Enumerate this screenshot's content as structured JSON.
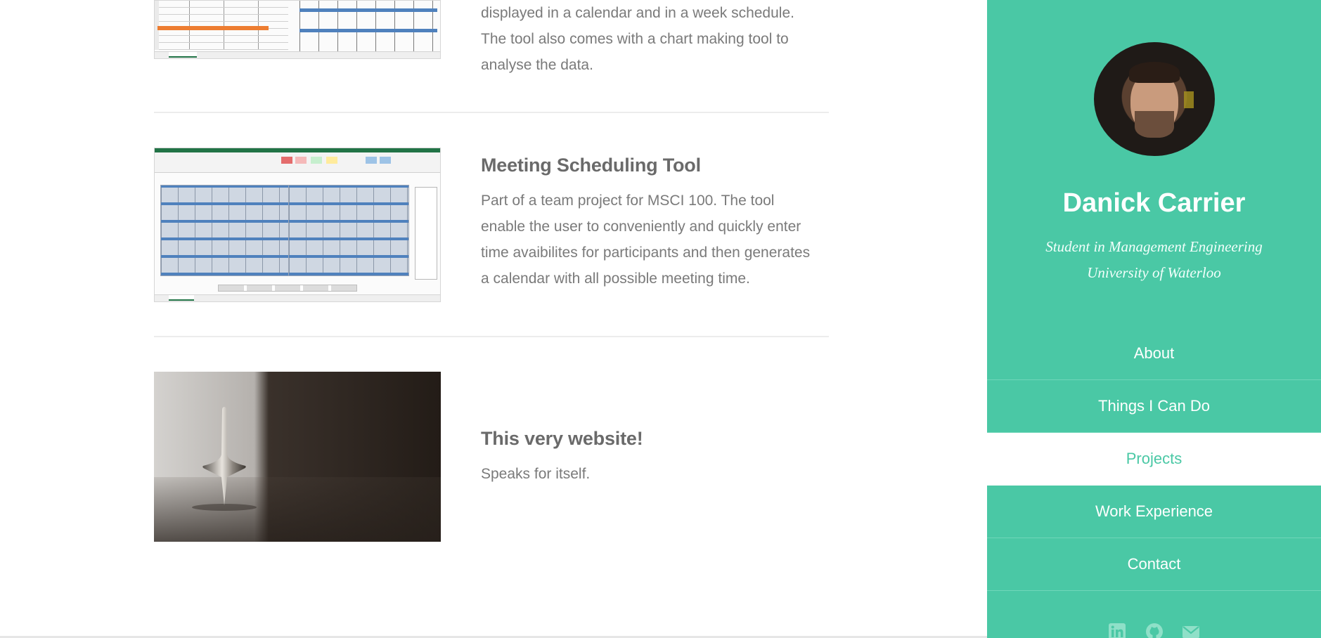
{
  "projects": [
    {
      "title": "",
      "description": "displayed in a calendar and in a week schedule. The tool also comes with a chart making tool to analyse the data."
    },
    {
      "title": "Meeting Scheduling Tool",
      "description": "Part of a team project for MSCI 100. The tool enable the user to conveniently and quickly enter time avaibilites for participants and then generates a calendar with all possible meeting time."
    },
    {
      "title": "This very website!",
      "description": "Speaks for itself."
    }
  ],
  "sidebar": {
    "name": "Danick Carrier",
    "subtitle_line1": "Student in Management Engineering",
    "subtitle_line2": "University of Waterloo",
    "nav": [
      {
        "label": "About",
        "active": false
      },
      {
        "label": "Things I Can Do",
        "active": false
      },
      {
        "label": "Projects",
        "active": true
      },
      {
        "label": "Work Experience",
        "active": false
      },
      {
        "label": "Contact",
        "active": false
      }
    ],
    "social_icons": [
      "linkedin-icon",
      "github-icon",
      "email-icon"
    ]
  },
  "colors": {
    "accent": "#4ac8a5",
    "text": "#757575",
    "excel_green": "#217346",
    "calendar_blue": "#4f81bd",
    "orange_bar": "#ed7d31"
  }
}
